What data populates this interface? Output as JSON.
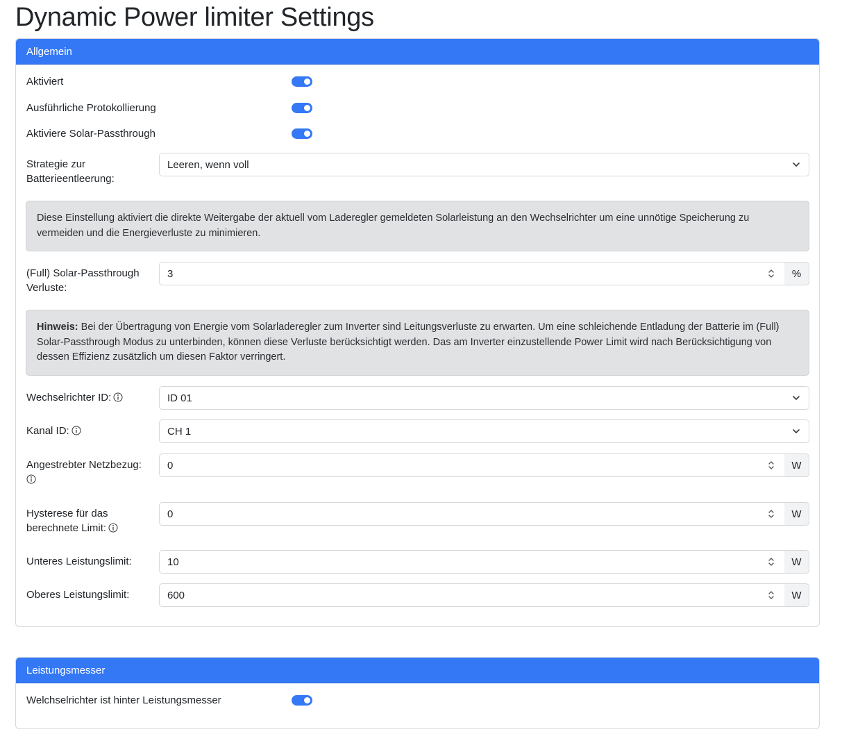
{
  "page": {
    "title": "Dynamic Power limiter Settings"
  },
  "general": {
    "header": "Allgemein",
    "enabled_label": "Aktiviert",
    "verbose_label": "Ausführliche Protokollierung",
    "passthrough_label": "Aktiviere Solar-Passthrough",
    "strategy_label_1": "Strategie zur",
    "strategy_label_2": "Batterieentleerung:",
    "strategy_value": "Leeren, wenn voll",
    "passthrough_info": "Diese Einstellung aktiviert die direkte Weitergabe der aktuell vom Laderegler gemeldeten Solarleistung an den Wechselrichter um eine unnötige Speicherung zu vermeiden und die Energieverluste zu minimieren.",
    "losses_label_1": "(Full) Solar-Passthrough",
    "losses_label_2": "Verluste:",
    "losses_value": "3",
    "losses_unit": "%",
    "hint_bold": "Hinweis:",
    "hint_text": " Bei der Übertragung von Energie vom Solarladeregler zum Inverter sind Leitungsverluste zu erwarten. Um eine schleichende Entladung der Batterie im (Full) Solar-Passthrough Modus zu unterbinden, können diese Verluste berücksichtigt werden. Das am Inverter einzustellende Power Limit wird nach Berücksichtigung von dessen Effizienz zusätzlich um diesen Faktor verringert.",
    "inverter_label": "Wechselrichter ID:",
    "inverter_value": "ID 01",
    "channel_label": "Kanal ID:",
    "channel_value": "CH 1",
    "target_label": "Angestrebter Netzbezug:",
    "target_value": "0",
    "target_unit": "W",
    "hysteresis_label_1": "Hysterese für das",
    "hysteresis_label_2": "berechnete Limit:",
    "hysteresis_value": "0",
    "hysteresis_unit": "W",
    "lower_label": "Unteres Leistungslimit:",
    "lower_value": "10",
    "lower_unit": "W",
    "upper_label": "Oberes Leistungslimit:",
    "upper_value": "600",
    "upper_unit": "W"
  },
  "meter": {
    "header": "Leistungsmesser",
    "behind_label": "Welchselrichter ist hinter Leistungsmesser"
  },
  "icons": {
    "info": "info-circle-icon",
    "chevron": "chevron-down-icon",
    "spinner": "spin-updown-icon"
  },
  "colors": {
    "accent": "#3478f6",
    "alert_bg": "#e1e2e4"
  }
}
